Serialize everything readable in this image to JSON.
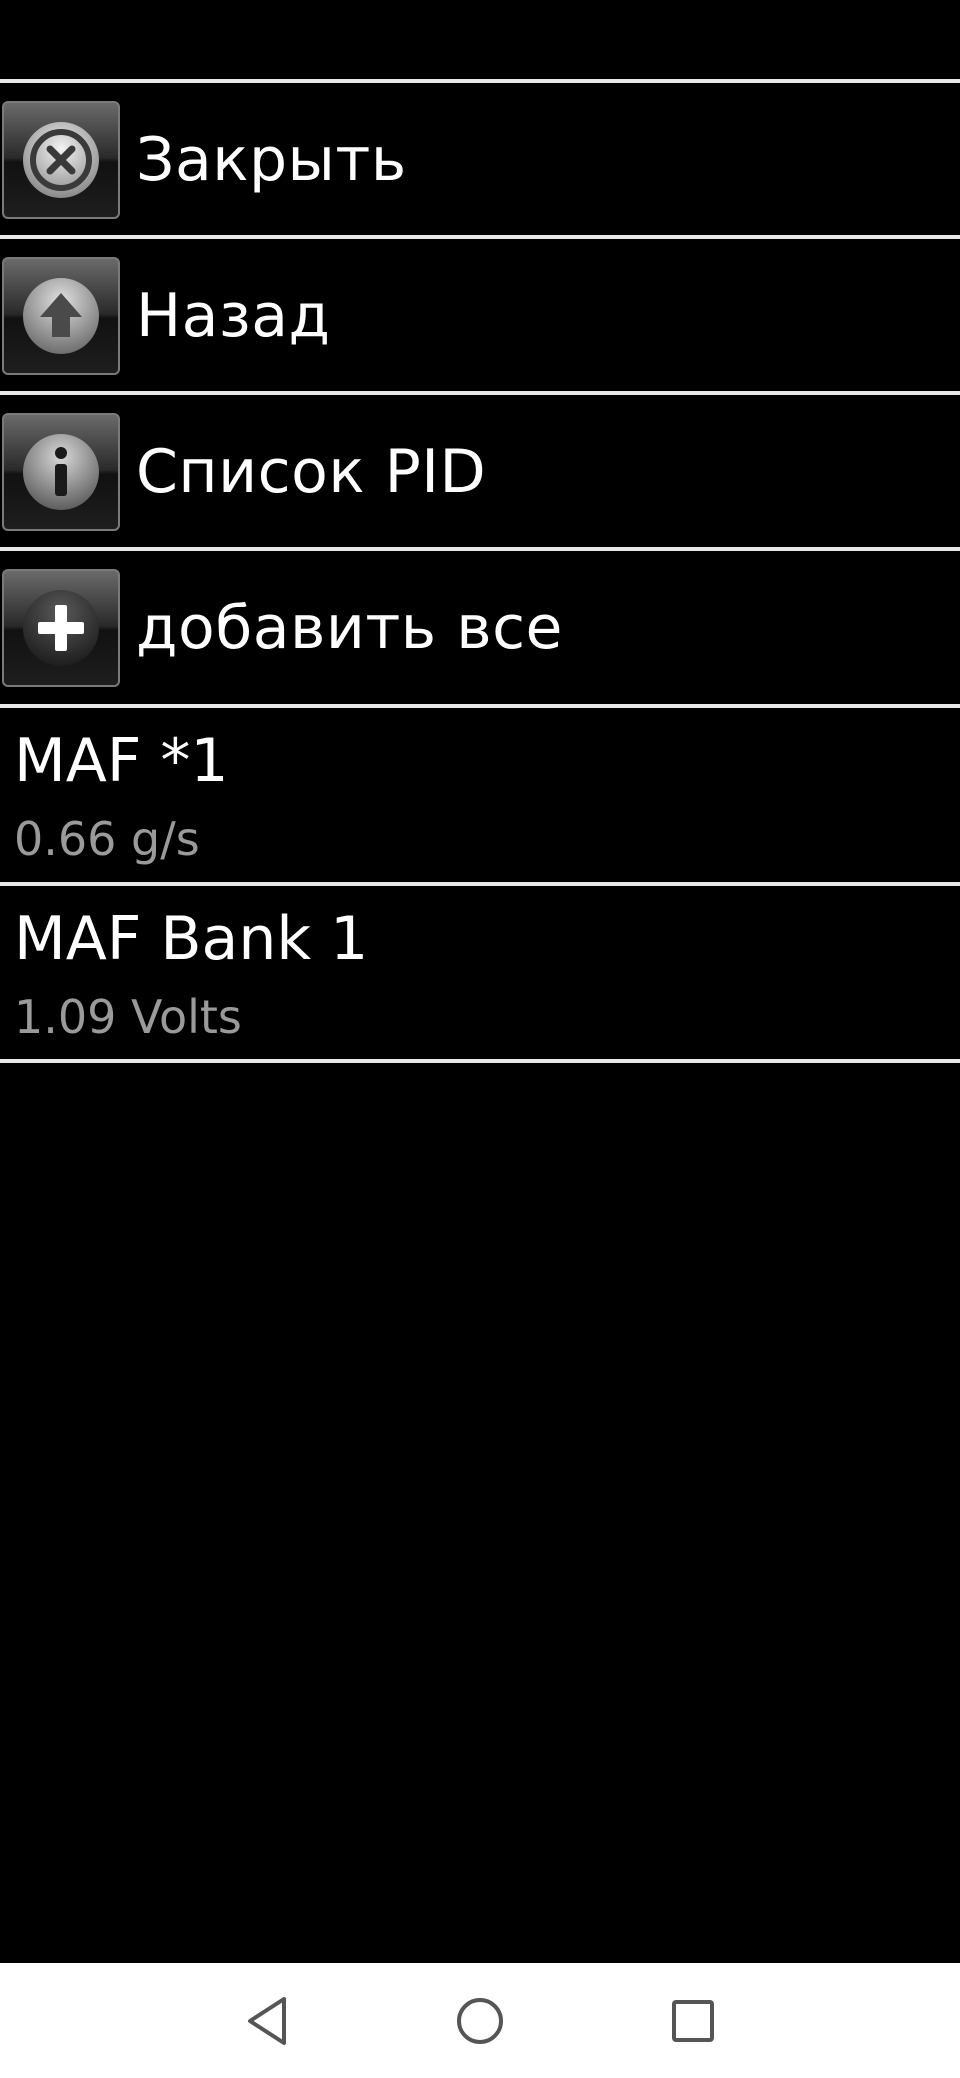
{
  "menu": {
    "close_label": "Закрыть",
    "back_label": "Назад",
    "pid_list_label": "Список PID",
    "add_all_label": "добавить все"
  },
  "pids": [
    {
      "name": "MAF *1",
      "value": "0.66 g/s"
    },
    {
      "name": "MAF Bank 1",
      "value": "1.09 Volts"
    }
  ],
  "icons": {
    "close": "close-circle-icon",
    "back": "arrow-up-icon",
    "info": "info-icon",
    "add": "plus-icon"
  },
  "colors": {
    "background": "#000000",
    "divider": "#e8e8e8",
    "text": "#ffffff",
    "subtext": "#9a9a9a",
    "navbar": "#ffffff",
    "nav_icon": "#555555"
  }
}
